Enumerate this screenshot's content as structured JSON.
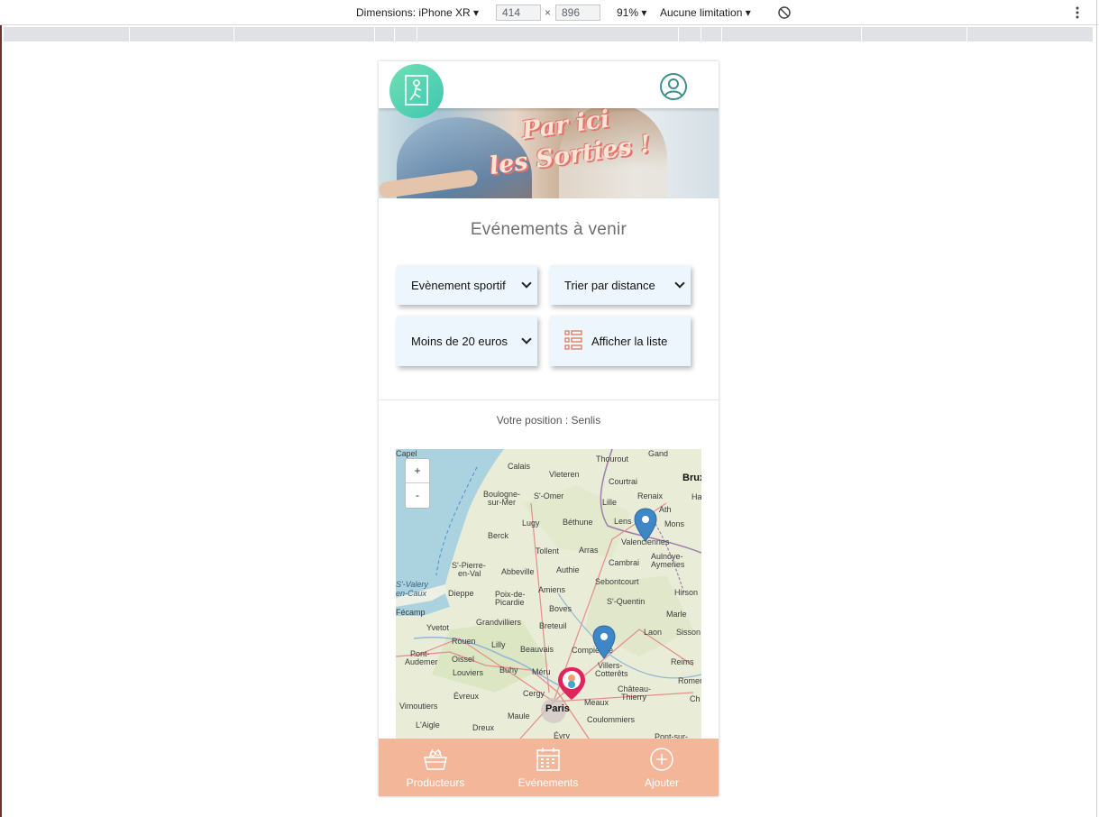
{
  "devtools": {
    "dimensions_label": "Dimensions: iPhone XR ▾",
    "width": "414",
    "height": "896",
    "times": "×",
    "zoom": "91% ▾",
    "throttling": "Aucune limitation ▾"
  },
  "header": {
    "logo_icon": "exit-door-icon",
    "profile_icon": "user-circle-icon"
  },
  "hero": {
    "title_line1": "Par ici",
    "title_line2": "les Sorties !"
  },
  "main": {
    "section_title": "Evénements à venir",
    "filters": {
      "category": "Evènement sportif",
      "sort": "Trier par distance",
      "price": "Moins de 20 euros",
      "list_button": "Afficher la liste"
    },
    "position_text": "Votre position : Senlis"
  },
  "map": {
    "zoom_in": "+",
    "zoom_out": "-",
    "cities": [
      "Capel",
      "Calais",
      "Vleteren",
      "Thourout",
      "Gand",
      "Brux",
      "Boulogne-",
      "sur-Mer",
      "S'-Omer",
      "Courtrai",
      "Lille",
      "Renaix",
      "Ha",
      "Lugy",
      "Béthune",
      "Lens",
      "Ath",
      "Mons",
      "Berck",
      "Arras",
      "Valenciennes",
      "Tollent",
      "Cambrai",
      "Aulnoye-",
      "Aymeries",
      "S'-Pierre-",
      "en-Val",
      "Abbeville",
      "Authie",
      "Sebontcourt",
      "Hirson",
      "S'-Valery",
      "en-Caux",
      "Dieppe",
      "Poix-de-",
      "Picardie",
      "Amiens",
      "S'-Quentin",
      "Boves",
      "Fécamp",
      "Grandvilliers",
      "Breteuil",
      "Marle",
      "Yvetot",
      "Laon",
      "Sisson",
      "Rouen",
      "Lilly",
      "Beauvais",
      "Compiègne",
      "Pont-",
      "Audemer",
      "Oissel",
      "Louviers",
      "Buhy",
      "Méru",
      "Villers-",
      "Cotterêts",
      "Reims",
      "Romer",
      "Évreux",
      "Cergy",
      "Meaux",
      "Château-",
      "Thierry",
      "Ch",
      "Vimoutiers",
      "L'Aigle",
      "Dreux",
      "Maule",
      "Paris",
      "Coulommiers",
      "Évry",
      "Pont-sur-"
    ],
    "event_marker_color": "#3f86c6",
    "user_marker_color": "#e0245e"
  },
  "bottom_nav": [
    {
      "label": "Producteurs",
      "icon": "basket-icon"
    },
    {
      "label": "Evénements",
      "icon": "calendar-icon"
    },
    {
      "label": "Ajouter",
      "icon": "plus-circle-icon"
    }
  ],
  "colors": {
    "nav_background": "#f3b699",
    "filter_background": "#eef6fd",
    "logo_green": "#5fd5b2"
  }
}
